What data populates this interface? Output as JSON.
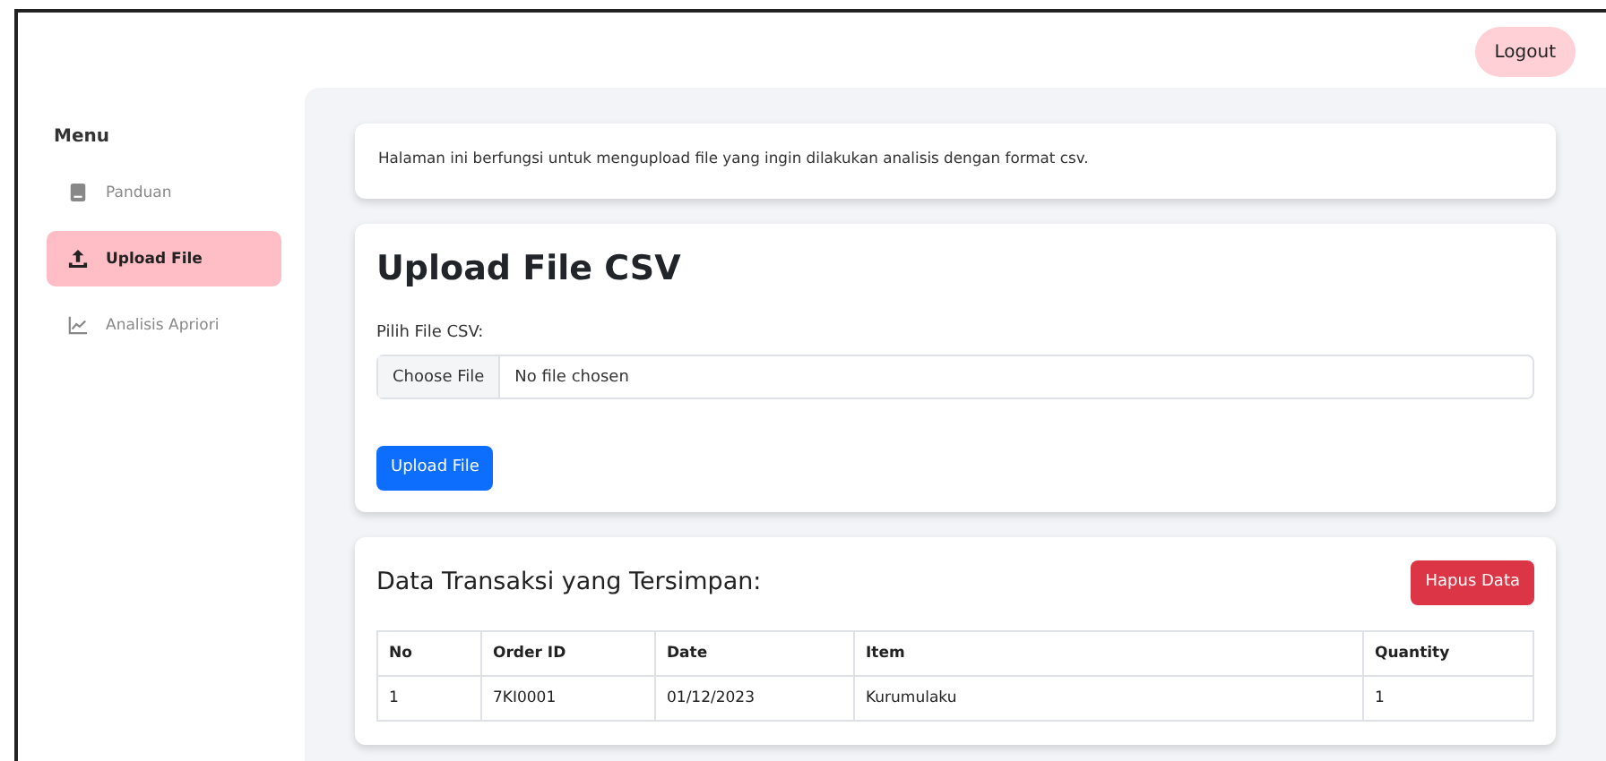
{
  "header": {
    "logout_label": "Logout"
  },
  "sidebar": {
    "heading": "Menu",
    "items": [
      {
        "label": "Panduan",
        "selected": false
      },
      {
        "label": "Upload File",
        "selected": true
      },
      {
        "label": "Analisis Apriori",
        "selected": false
      }
    ]
  },
  "info_card": {
    "text": "Halaman ini berfungsi untuk mengupload file yang ingin dilakukan analisis dengan format csv."
  },
  "upload_card": {
    "title": "Upload File CSV",
    "field_label": "Pilih File CSV:",
    "choose_button": "Choose File",
    "file_status": "No file chosen",
    "submit_button": "Upload File"
  },
  "data_card": {
    "title": "Data Transaksi yang Tersimpan:",
    "delete_button": "Hapus Data",
    "table": {
      "columns": [
        "No",
        "Order ID",
        "Date",
        "Item",
        "Quantity"
      ],
      "rows": [
        [
          "1",
          "7KI0001",
          "01/12/2023",
          "Kurumulaku",
          "1"
        ]
      ]
    }
  }
}
